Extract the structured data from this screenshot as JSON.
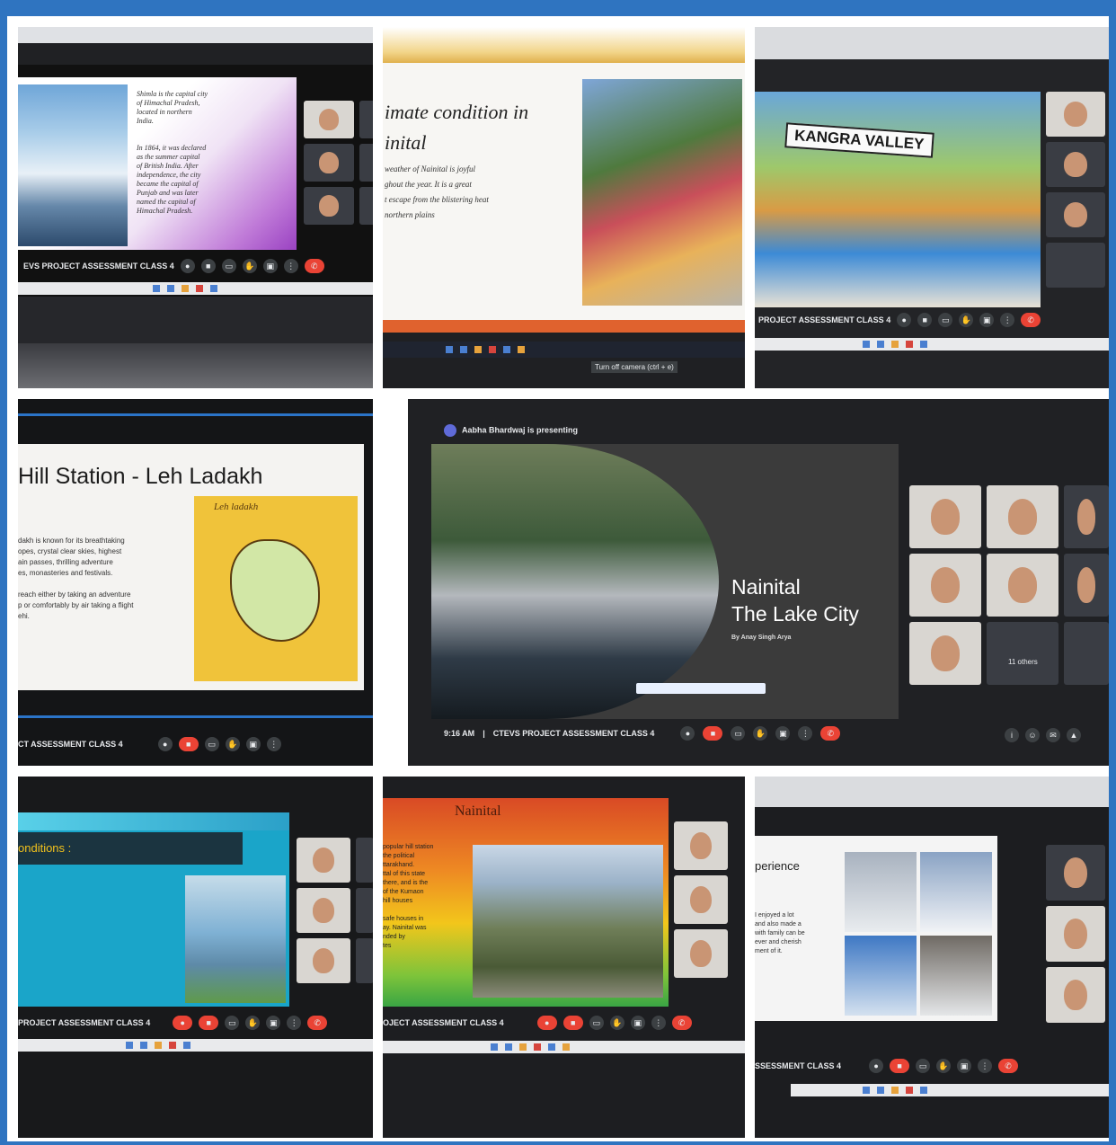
{
  "panel1": {
    "paragraph1": "Shimla is the capital city\nof Himachal Pradesh,\nlocated in northern\nIndia.",
    "paragraph2": "In 1864, it was declared\nas the summer capital\nof British India. After\nindependence, the city\nbecame the capital of\nPunjab and was later\nnamed the capital of\nHimachal Pradesh.",
    "meet_label": "EVS PROJECT ASSESSMENT CLASS 4"
  },
  "panel2": {
    "title": "imate condition in\ninital",
    "body": "weather of Nainital is joyful\nghout the year. It is a great\nt escape from the blistering heat\nnorthern plains",
    "caption": "Turn off camera (ctrl + e)"
  },
  "panel3": {
    "poster_title": "KANGRA VALLEY",
    "meet_label": "PROJECT ASSESSMENT CLASS 4"
  },
  "panel4": {
    "title": "Hill Station - Leh Ladakh",
    "body": "dakh is known for its breathtaking\nopes, crystal clear skies, highest\nain passes, thrilling adventure\nes, monasteries and festivals.\n\nreach either by taking an adventure\np or comfortably by air taking a flight\nehi.",
    "map_title": "Leh ladakh",
    "meet_label": "CT ASSESSMENT CLASS 4"
  },
  "panel5": {
    "presenting": "Aabha Bhardwaj is presenting",
    "title_line1": "Nainital",
    "title_line2": "The Lake City",
    "byline": "By Anay Singh Arya",
    "others": "11 others",
    "time": "9:16 AM",
    "meet_label": "CTEVS PROJECT ASSESSMENT CLASS 4"
  },
  "panel6": {
    "heading": "onditions :",
    "meet_label": "PROJECT ASSESSMENT CLASS 4"
  },
  "panel7": {
    "title": "Nainital",
    "body": "popular hill station\nthe political\nttarakhand.\nttal of this state\nthere, and is the\nof the Kumaon\nhill houses\n\nsafe houses in\nay. Nainital was\nnded by\ntes",
    "meet_label": "OJECT ASSESSMENT CLASS 4"
  },
  "panel8": {
    "heading": "perience",
    "body": "I enjoyed a lot\nand also made a\nwith family can be\never and cherish\nment of it.",
    "meet_label": "SSESSMENT CLASS 4"
  },
  "colors": {
    "border_blue": "#2f74c0",
    "meet_red": "#ea4335",
    "meet_dark": "#202124"
  }
}
